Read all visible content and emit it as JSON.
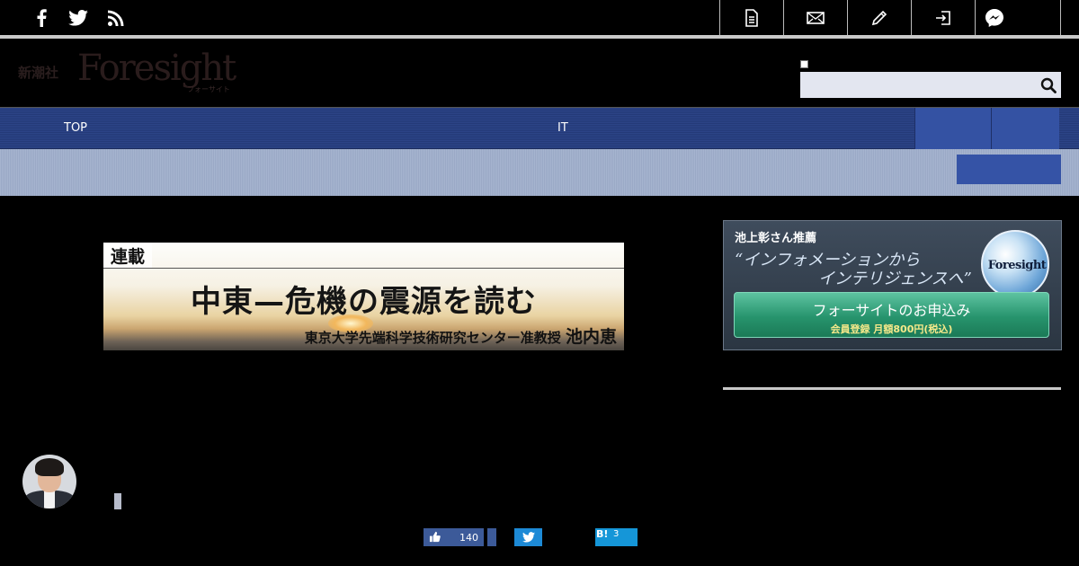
{
  "topbar": {
    "social": [
      {
        "name": "facebook",
        "glyph": "f"
      },
      {
        "name": "twitter",
        "glyph": ""
      },
      {
        "name": "rss",
        "glyph": ""
      }
    ],
    "tools": [
      "document-icon",
      "mail-icon",
      "pencil-icon",
      "login-icon",
      "messenger-icon"
    ]
  },
  "header": {
    "logo_small": "新潮社",
    "logo_main": "Foresight",
    "logo_sub": "フォーサイト",
    "search_placeholder": ""
  },
  "nav": {
    "items": [
      {
        "label": "TOP"
      },
      {
        "label": "IT"
      }
    ]
  },
  "banner": {
    "tag": "連載",
    "title": "中東—危機の震源を読む",
    "author_title": "東京大学先端科学技術研究センター准教授",
    "author_name": "池内恵"
  },
  "ad": {
    "recommend": "池上彰さん推薦",
    "quote_line1": "“インフォメーションから",
    "quote_line2": "インテリジェンスへ”",
    "globe_label": "Foresight",
    "button_main": "フォーサイトのお申込み",
    "button_sub": "会員登録 月額800円(税込)"
  },
  "share": {
    "fb_like_count": "140",
    "hatena_label": "B!",
    "hatena_count": "3"
  },
  "colors": {
    "nav_bg": "#2c4487",
    "nav_block": "#3452a3",
    "subbar_bg": "#a6b4cf",
    "ad_button": "#27946d",
    "facebook": "#3c5a99",
    "twitter": "#1d8ad6",
    "hatena": "#1596d8"
  }
}
